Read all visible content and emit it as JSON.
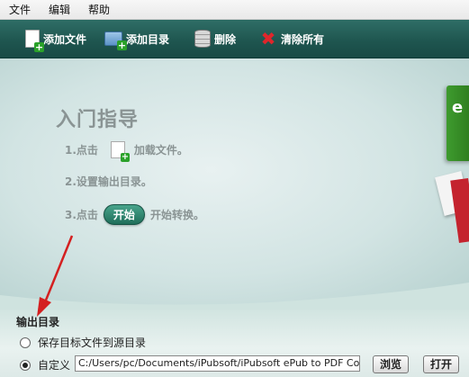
{
  "menu": [
    "文件",
    "编辑",
    "帮助"
  ],
  "toolbar": {
    "add_file": "添加文件",
    "add_folder": "添加目录",
    "delete": "删除",
    "clear_all": "清除所有"
  },
  "guide": {
    "title": "入门指导",
    "step1_prefix": "1.点击",
    "step1_suffix": "加载文件。",
    "step2": "2.设置输出目录。",
    "step3_prefix": "3.点击",
    "start_label": "开始",
    "step3_suffix": "开始转换。"
  },
  "book_letter": "e",
  "output": {
    "title": "输出目录",
    "option_source": "保存目标文件到源目录",
    "option_custom": "自定义",
    "path_value": "C:/Users/pc/Documents/iPubsoft/iPubsoft ePub to PDF Converter",
    "selected": "custom",
    "browse_label": "浏览",
    "open_label": "打开"
  },
  "colors": {
    "toolbar": "#1f5650",
    "accent_green": "#2aa12a",
    "delete_red": "#e0262b",
    "arrow_red": "#d42020"
  }
}
